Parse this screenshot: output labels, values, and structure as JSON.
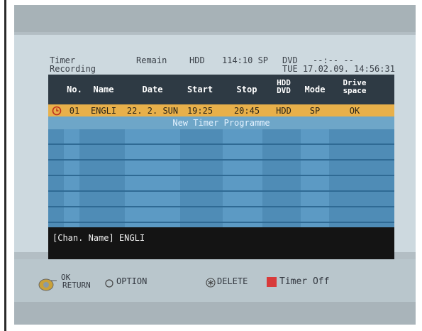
{
  "header": {
    "title_line1": "Timer",
    "title_line2": "Recording",
    "remain_label": "Remain",
    "hdd_label": "HDD",
    "hdd_remain": "114:10 SP",
    "dvd_label": "DVD",
    "dvd_remain": "--:-- --",
    "datetime": "TUE 17.02.09. 14:56:31"
  },
  "table": {
    "columns": {
      "no": "No.",
      "name": "Name",
      "date": "Date",
      "start": "Start",
      "stop": "Stop",
      "hdd_dvd_1": "HDD",
      "hdd_dvd_2": "DVD",
      "mode": "Mode",
      "drive_1": "Drive",
      "drive_2": "space"
    },
    "rows": [
      {
        "no": "01",
        "name": "ENGLI",
        "date": "22. 2. SUN",
        "start": "19:25",
        "stop": "20:45",
        "dest": "HDD",
        "mode": "SP",
        "drive": "OK"
      }
    ],
    "new_programme": "New Timer Programme"
  },
  "channel_info": "[Chan. Name] ENGLI",
  "footer": {
    "ok": "OK",
    "return": "RETURN",
    "option": "OPTION",
    "delete": "DELETE",
    "timer_off": "Timer Off"
  },
  "colors": {
    "selected_row": "#e8b04a",
    "table_blue": "#5c9ac4",
    "timer_off_red": "#d83a3a"
  }
}
